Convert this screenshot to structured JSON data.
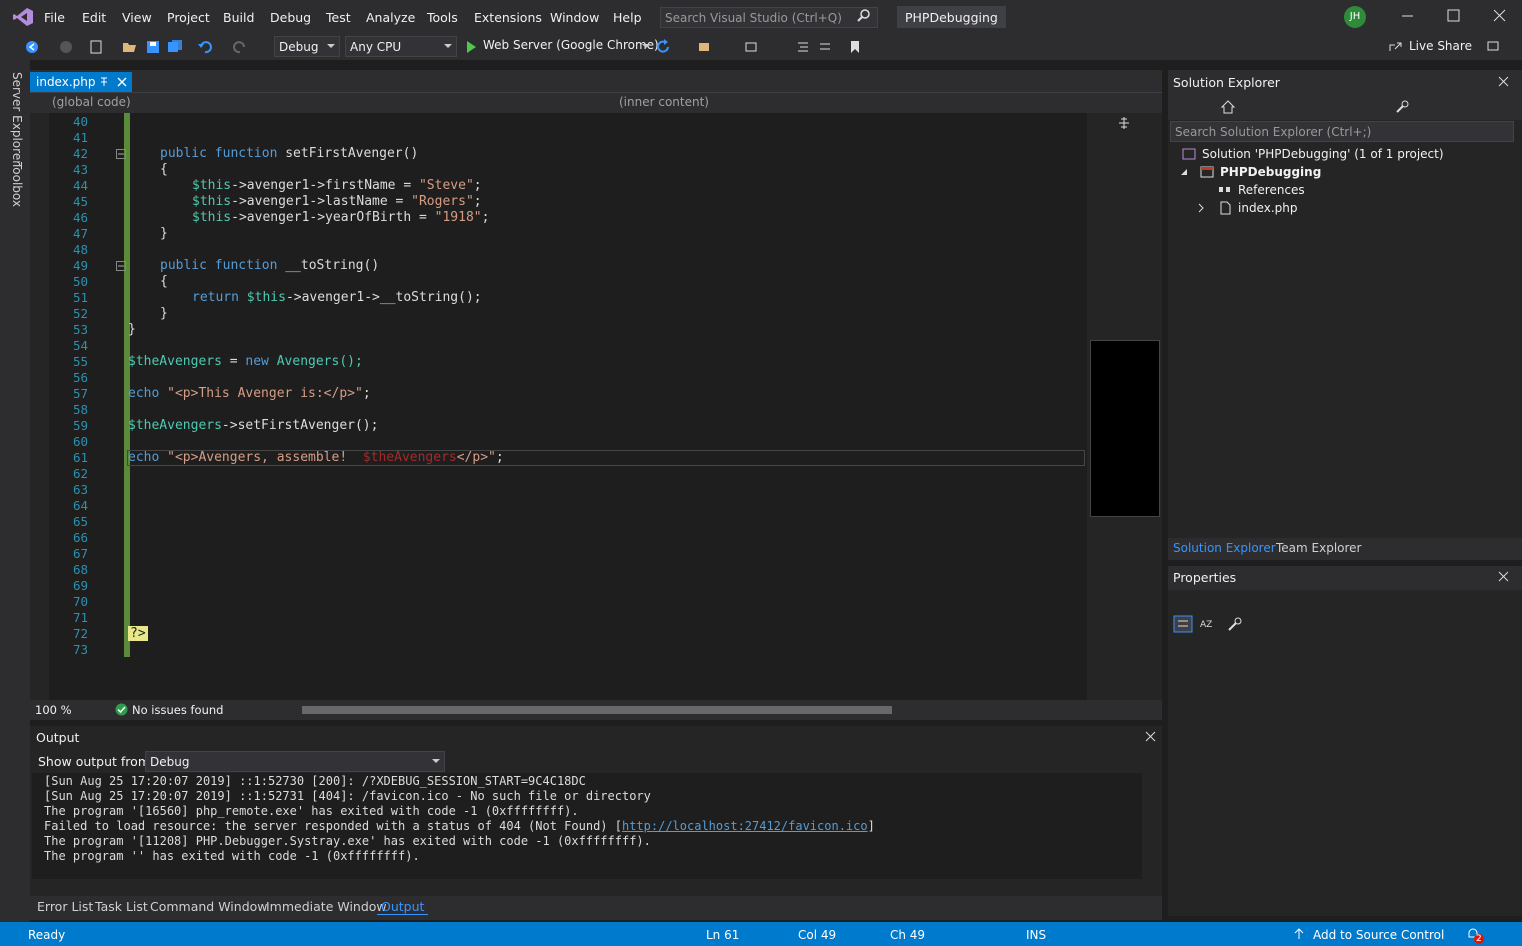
{
  "menu": {
    "items": [
      "File",
      "Edit",
      "View",
      "Project",
      "Build",
      "Debug",
      "Test",
      "Analyze",
      "Tools",
      "Extensions",
      "Window",
      "Help"
    ],
    "search_placeholder": "Search Visual Studio (Ctrl+Q)",
    "solution_title": "PHPDebugging",
    "avatar_initials": "JH"
  },
  "toolbar": {
    "config": "Debug",
    "platform": "Any CPU",
    "run_target": "Web Server (Google Chrome)",
    "live_share": "Live Share"
  },
  "left_tabs": [
    "Server Explorer",
    "Toolbox"
  ],
  "editor": {
    "tab_label": "index.php",
    "nav_left": "(global code)",
    "nav_right": "(inner content)",
    "zoom": "100 %",
    "issues": "No issues found",
    "line_numbers": [
      "40",
      "41",
      "42",
      "43",
      "44",
      "45",
      "46",
      "47",
      "48",
      "49",
      "50",
      "51",
      "52",
      "53",
      "54",
      "55",
      "56",
      "57",
      "58",
      "59",
      "60",
      "61",
      "62",
      "63",
      "64",
      "65",
      "66",
      "67",
      "68",
      "69",
      "70",
      "71",
      "72",
      "73"
    ],
    "code": {
      "l42_kw": "public function",
      "l42_rest": " setFirstAvenger()",
      "l43": "{",
      "l44_var": "$this",
      "l44_mid": "->avenger1->firstName = ",
      "l44_str": "\"Steve\"",
      "l45_var": "$this",
      "l45_mid": "->avenger1->lastName = ",
      "l45_str": "\"Rogers\"",
      "l46_var": "$this",
      "l46_mid": "->avenger1->yearOfBirth = ",
      "l46_str": "\"1918\"",
      "l47": "}",
      "l49_kw": "public function",
      "l49_rest": " __toString()",
      "l50": "{",
      "l51_kw": "return",
      "l51_var": " $this",
      "l51_rest": "->avenger1->__toString();",
      "l52": "}",
      "l53": "}",
      "l55_var": "$theAvengers",
      "l55_eq": " = ",
      "l55_kw": "new",
      "l55_rest": " Avengers();",
      "l57_kw": "echo",
      "l57_str": " \"<p>This Avenger is:</p>\"",
      "l57_end": ";",
      "l59_var": "$theAvengers",
      "l59_rest": "->setFirstAvenger();",
      "l61_kw": "echo",
      "l61_str1": " \"<p>Avengers, assemble!  ",
      "l61_var": "$theAvengers",
      "l61_str2": "</p>\"",
      "l61_end": ";",
      "l72": "?>"
    }
  },
  "output": {
    "title": "Output",
    "show_from_label": "Show output from:",
    "show_from_value": "Debug",
    "lines": [
      "[Sun Aug 25 17:20:07 2019] ::1:52730 [200]: /?XDEBUG_SESSION_START=9C4C18DC",
      "[Sun Aug 25 17:20:07 2019] ::1:52731 [404]: /favicon.ico - No such file or directory",
      "The program '[16560] php_remote.exe' has exited with code -1 (0xffffffff).",
      "Failed to load resource: the server responded with a status of 404 (Not Found) [",
      "The program '[11208] PHP.Debugger.Systray.exe' has exited with code -1 (0xffffffff).",
      "The program '' has exited with code -1 (0xffffffff)."
    ],
    "link": "http://localhost:27412/favicon.ico",
    "link_end": "]",
    "tabs": [
      "Error List",
      "Task List",
      "Command Window",
      "Immediate Window",
      "Output"
    ]
  },
  "solution_explorer": {
    "title": "Solution Explorer",
    "search_placeholder": "Search Solution Explorer (Ctrl+;)",
    "solution": "Solution 'PHPDebugging' (1 of 1 project)",
    "project": "PHPDebugging",
    "references": "References",
    "file": "index.php",
    "tabs": [
      "Solution Explorer",
      "Team Explorer"
    ]
  },
  "properties": {
    "title": "Properties"
  },
  "status": {
    "ready": "Ready",
    "ln": "Ln 61",
    "col": "Col 49",
    "ch": "Ch 49",
    "ins": "INS",
    "source_control": "Add to Source Control",
    "notif_count": "2"
  }
}
